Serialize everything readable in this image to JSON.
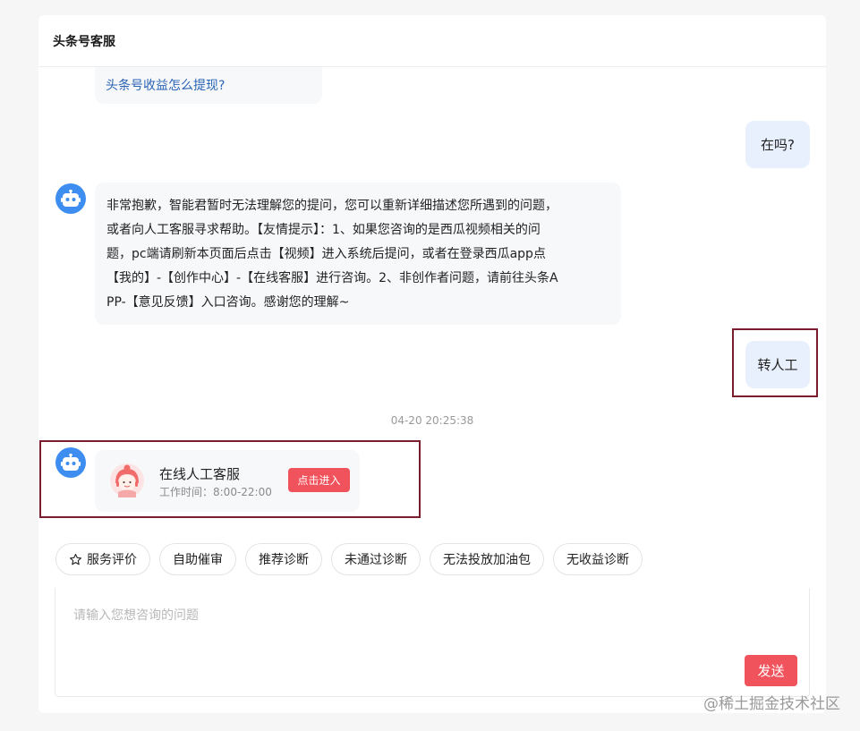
{
  "header": {
    "title": "头条号客服"
  },
  "messages": {
    "link_question": "头条号收益怎么提现?",
    "user_1": "在吗?",
    "bot_reply_lines": [
      "非常抱歉，智能君暂时无法理解您的提问，您可以重新详细描述您所遇到的问题，",
      "或者向人工客服寻求帮助。【友情提示】：1、如果您咨询的是西瓜视频相关的问",
      "题，pc端请刷新本页面后点击【视频】进入系统后提问，或者在登录西瓜app点",
      "【我的】-【创作中心】-【在线客服】进行咨询。2、非创作者问题，请前往头条A",
      "PP-【意见反馈】入口咨询。感谢您的理解~"
    ],
    "user_2": "转人工",
    "timestamp": "04-20 20:25:38"
  },
  "agent_card": {
    "title": "在线人工客服",
    "hours": "工作时间：8:00-22:00",
    "enter_label": "点击进入"
  },
  "quick_chips": [
    {
      "label": "服务评价",
      "icon": "star-icon"
    },
    {
      "label": "自助催审"
    },
    {
      "label": "推荐诊断"
    },
    {
      "label": "未通过诊断"
    },
    {
      "label": "无法投放加油包"
    },
    {
      "label": "无收益诊断"
    }
  ],
  "input": {
    "placeholder": "请输入您想咨询的问题",
    "value": ""
  },
  "send_label": "发送",
  "watermark": "@稀土掘金技术社区",
  "colors": {
    "accent_red": "#f0535b",
    "user_bubble": "#e8f0fd",
    "bot_avatar": "#3d8ef0",
    "link": "#2a64b4",
    "highlight_border": "#7a1d2c"
  }
}
